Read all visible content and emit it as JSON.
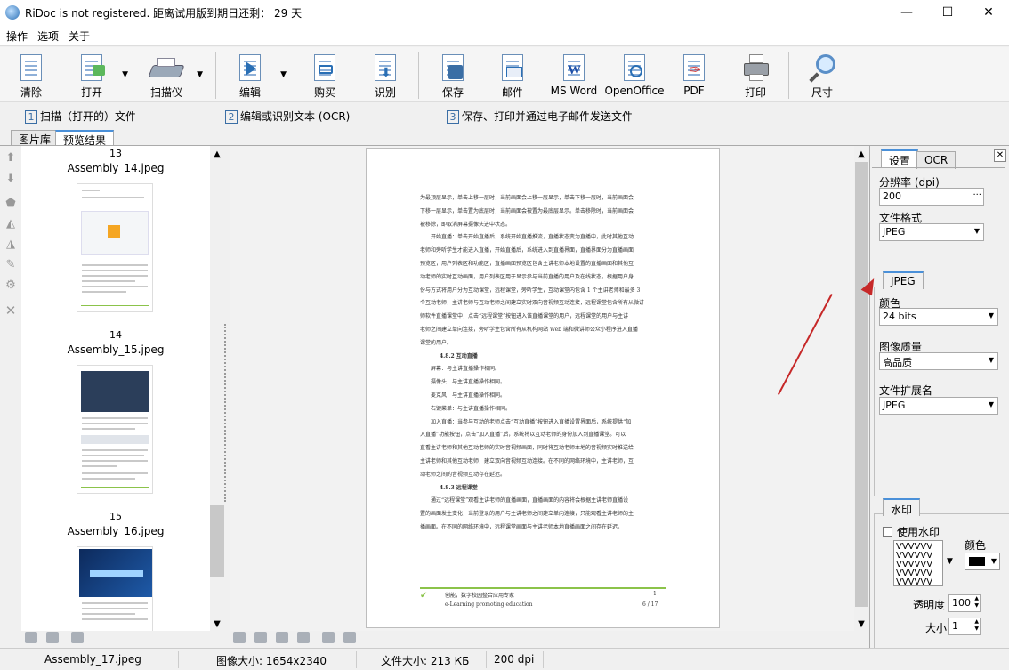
{
  "window": {
    "title": "RiDoc is not registered. 距离试用版到期日还剩：  29 天",
    "minimize": "—",
    "maximize": "☐",
    "close": "✕"
  },
  "menu": [
    "操作",
    "选项",
    "关于"
  ],
  "toolbar": {
    "clear": "清除",
    "open": "打开",
    "scanner": "扫描仪",
    "edit": "编辑",
    "buy": "购买",
    "recognize": "识别",
    "save": "保存",
    "mail": "邮件",
    "msword": "MS Word",
    "openoffice": "OpenOffice",
    "pdf": "PDF",
    "print": "打印",
    "size": "尺寸"
  },
  "steps": [
    {
      "num": "1",
      "text": "扫描（打开的）文件"
    },
    {
      "num": "2",
      "text": "编辑或识别文本 (OCR)"
    },
    {
      "num": "3",
      "text": "保存、打印并通过电子邮件发送文件"
    }
  ],
  "tabs": {
    "gallery": "图片库",
    "preview": "预览结果"
  },
  "thumbnails": [
    {
      "num": "13",
      "name": "Assembly_14.jpeg"
    },
    {
      "num": "14",
      "name": "Assembly_15.jpeg"
    },
    {
      "num": "15",
      "name": "Assembly_16.jpeg"
    }
  ],
  "document": {
    "paragraphs": [
      "为最顶层显示，单击上移一层时，当前画面会上移一层显示，单击下移一层时，当前画面会",
      "下移一层显示，单击置为底层时，当前画面会被置为最底层显示。单击移除时，当前画面会",
      "被移除，即取消屏幕摄像头进中状态。",
      "开始直播：单击开始直播后，系统开始直播推流，直播状态变为直播中，此时其他互动",
      "老师和旁听学生才能进入直播，开始直播后，系统进入到直播界面，直播界面分为直播画面",
      "预览区，用户列表区和功能区，直播画面预览区包含主讲老师本地设置的直播画面和其他互",
      "动老师的实时互动画面，用户列表区用于显示参与当前直播的用户及在线状态，根据用户身",
      "份与方式将用户分为互动课堂，远程课堂，旁听学生，互动课堂内包含 1 个主讲老师和最多 3",
      "个互动老师，主讲老师与互动老师之间建立实时双向音视频互动连接，远程课堂包含所有从微讲",
      "师软件直播课堂中，点击“远程课堂”按钮进入该直播课堂的用户，远程课堂的用户与主讲",
      "老师之间建立单向连接，旁听学生包含所有从机构网站 Web 端和微讲师公众小程序进入直播",
      "课堂的用户。"
    ],
    "heading1": "4.8.2  互动直播",
    "items": [
      "屏幕：与主讲直播操作相同。",
      "摄像头：与主讲直播操作相同。",
      "麦克风：与主讲直播操作相同。",
      "右键菜单：与主讲直播操作相同。"
    ],
    "paragraphs2": [
      "加入直播：当参与互动的老师点击“互动直播”按钮进入直播设置界面后，系统提供“加",
      "入直播”功能按钮，点击“加入直播”后，系统将以互动老师的身份加入到直播课堂。可以",
      "直看主讲老师和其他互动老师的实时音视频画面，同时将互动老师本地的音视频实时推送给",
      "主讲老师和其他互动老师，建立双向音视频互动连接。在不同的网络环境中，主讲老师，互",
      "动老师之间的音视频互动存在延迟。"
    ],
    "heading2": "4.8.3  远程课堂",
    "paragraphs3": [
      "通过“远程课堂”观看主讲老师的直播画面，直播画面的内容将会根据主讲老师直播设",
      "置的画面发生变化，当前登录的用户与主讲老师之间建立单向连接，只能观看主讲老师的主",
      "播画面。在不同的网络环境中，远程课堂画面与主讲老师本地直播画面之间存在延迟。"
    ],
    "footer_left": "创能，数字校园整合应用专家",
    "footer_sub": "e-Learning promoting education",
    "footer_page1": "1",
    "footer_page2": "6 / 17"
  },
  "panel": {
    "tab_settings": "设置",
    "tab_ocr": "OCR",
    "dpi_label": "分辨率 (dpi)",
    "dpi_value": "200",
    "dpi_btn": "···",
    "format_label": "文件格式",
    "format_value": "JPEG",
    "jpeg_tab": "JPEG",
    "color_label": "颜色",
    "color_value": "24 bits",
    "quality_label": "图像质量",
    "quality_value": "高品质",
    "ext_label": "文件扩展名",
    "ext_value": "JPEG",
    "watermark_tab": "水印",
    "use_watermark": "使用水印",
    "wm_color_label": "颜色",
    "opacity_label": "透明度",
    "opacity_value": "100",
    "size_label": "大小",
    "size_value": "1",
    "close": "✕"
  },
  "status": {
    "file": "Assembly_17.jpeg",
    "image_size": "图像大小: 1654x2340",
    "file_size": "文件大小: 213 КБ",
    "dpi": "200 dpi"
  }
}
